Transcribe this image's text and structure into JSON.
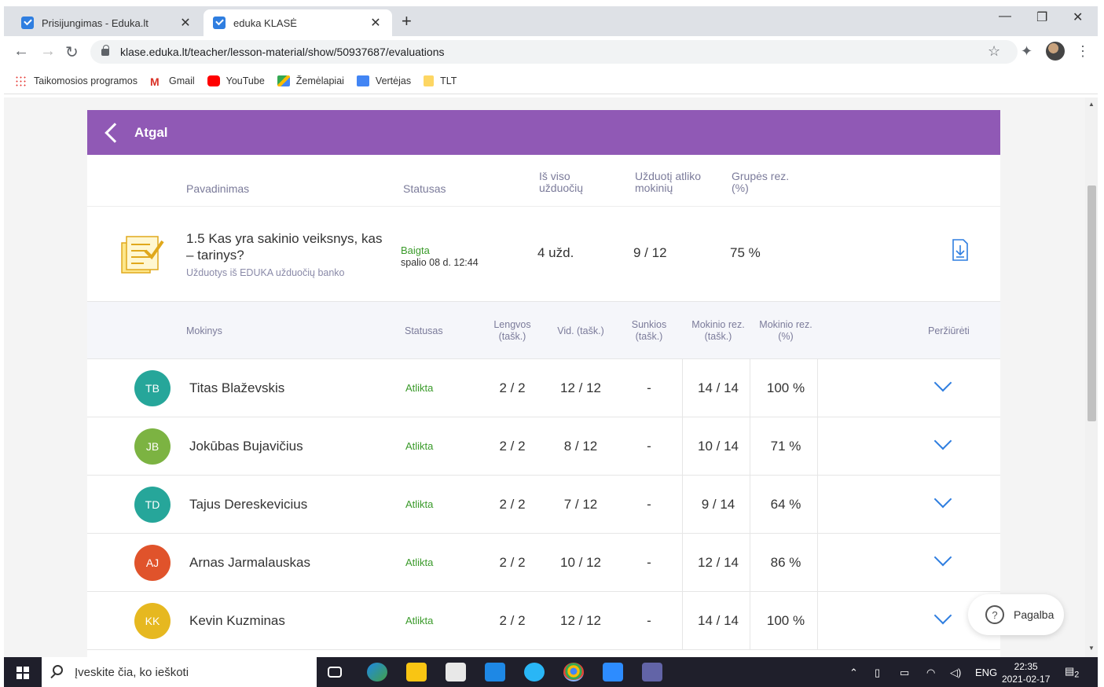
{
  "browser": {
    "tabs": [
      {
        "title": "Prisijungimas - Eduka.lt"
      },
      {
        "title": "eduka KLASĖ"
      }
    ],
    "url": "klase.eduka.lt/teacher/lesson-material/show/50937687/evaluations",
    "bookmarks": [
      {
        "label": "Taikomosios programos"
      },
      {
        "label": "Gmail"
      },
      {
        "label": "YouTube"
      },
      {
        "label": "Žemėlapiai"
      },
      {
        "label": "Vertėjas"
      },
      {
        "label": "TLT"
      }
    ]
  },
  "header": {
    "back_label": "Atgal"
  },
  "lesson_headers": {
    "name": "Pavadinimas",
    "status": "Statusas",
    "total": "Iš viso užduočių",
    "completed": "Užduotį atliko mokinių",
    "group": "Grupės rez. (%)"
  },
  "lesson": {
    "title": "1.5 Kas yra sakinio veiksnys, kas – tarinys?",
    "source": "Užduotys iš EDUKA užduočių banko",
    "status": "Baigta",
    "status_date": "spalio 08 d. 12:44",
    "tasks": "4 užd.",
    "students_done": "9 / 12",
    "group_result": "75 %"
  },
  "student_headers": {
    "student": "Mokinys",
    "status": "Statusas",
    "easy": "Lengvos (tašk.)",
    "medium": "Vid. (tašk.)",
    "hard": "Sunkios (tašk.)",
    "score": "Mokinio rez. (tašk.)",
    "percent": "Mokinio rez. (%)",
    "view": "Peržiūrėti"
  },
  "students": [
    {
      "initials": "TB",
      "name": "Titas Blaževskis",
      "status": "Atlikta",
      "easy": "2 / 2",
      "medium": "12 / 12",
      "hard": "-",
      "score": "14 / 14",
      "percent": "100 %",
      "color": "#26a69a"
    },
    {
      "initials": "JB",
      "name": "Jokūbas Bujavičius",
      "status": "Atlikta",
      "easy": "2 / 2",
      "medium": "8 / 12",
      "hard": "-",
      "score": "10 / 14",
      "percent": "71 %",
      "color": "#7cb342"
    },
    {
      "initials": "TD",
      "name": "Tajus Dereskevicius",
      "status": "Atlikta",
      "easy": "2 / 2",
      "medium": "7 / 12",
      "hard": "-",
      "score": "9 / 14",
      "percent": "64 %",
      "color": "#26a69a"
    },
    {
      "initials": "AJ",
      "name": "Arnas Jarmalauskas",
      "status": "Atlikta",
      "easy": "2 / 2",
      "medium": "10 / 12",
      "hard": "-",
      "score": "12 / 14",
      "percent": "86 %",
      "color": "#e0532b"
    },
    {
      "initials": "KK",
      "name": "Kevin Kuzminas",
      "status": "Atlikta",
      "easy": "2 / 2",
      "medium": "12 / 12",
      "hard": "-",
      "score": "14 / 14",
      "percent": "100 %",
      "color": "#e6b820"
    }
  ],
  "help": {
    "label": "Pagalba"
  },
  "taskbar": {
    "search_placeholder": "Įveskite čia, ko ieškoti",
    "language": "ENG",
    "time": "22:35",
    "date": "2021-02-17",
    "notifications": "2"
  },
  "colors": {
    "accent": "#9059b5",
    "link": "#2f7ee0",
    "done": "#3a9a2a"
  }
}
